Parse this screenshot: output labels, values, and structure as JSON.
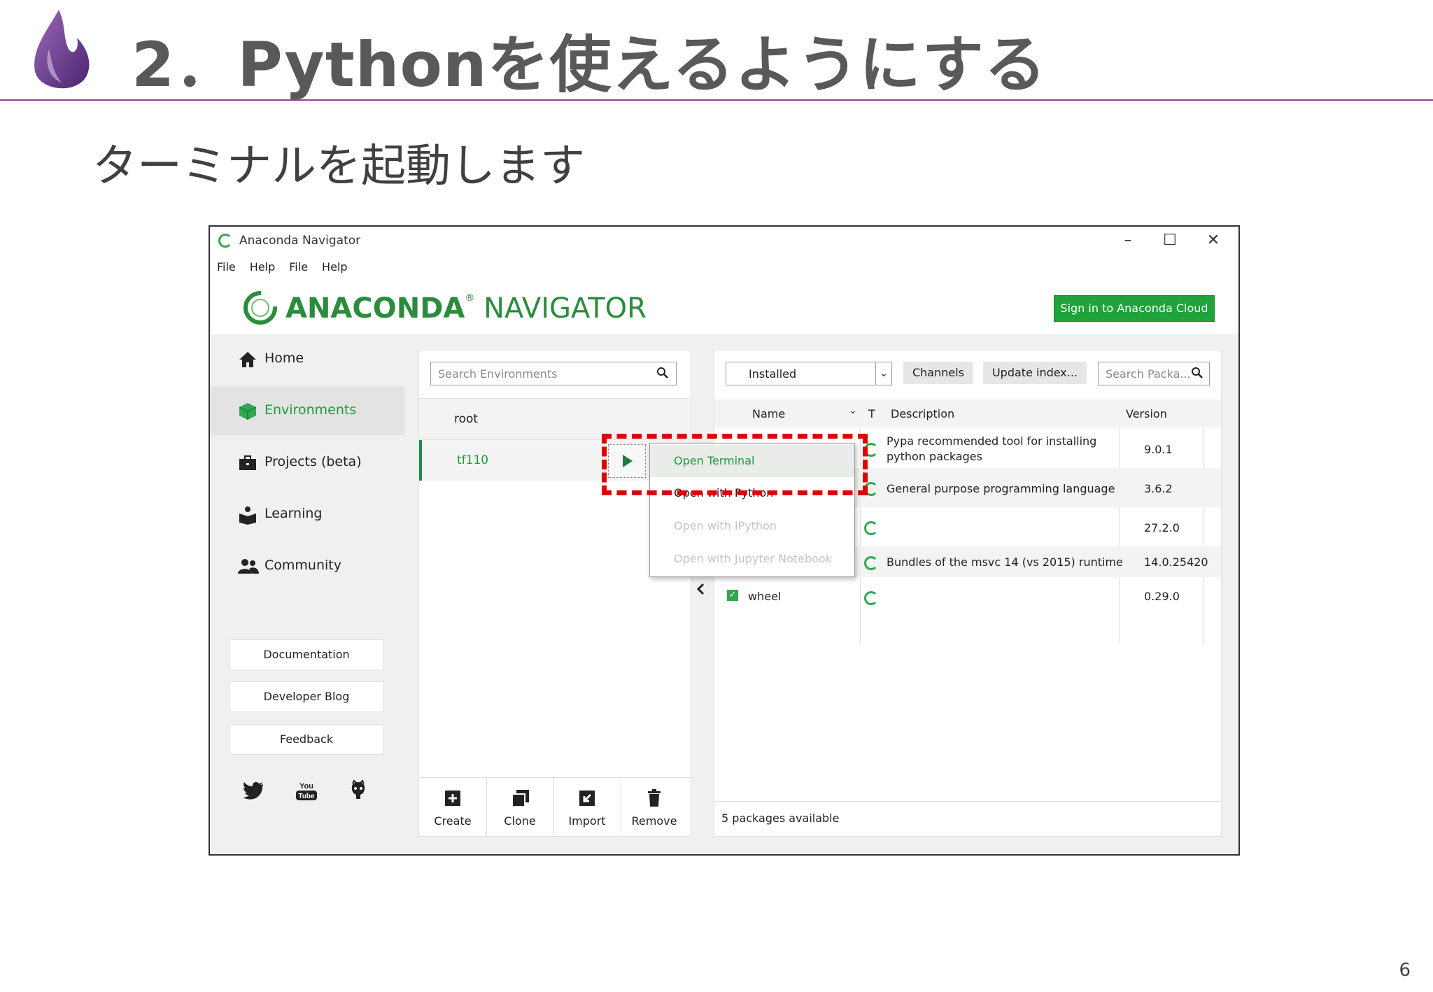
{
  "slide": {
    "title": "2．Pythonを使えるようにする",
    "subtitle": "ターミナルを起動します",
    "page_number": "6"
  },
  "window": {
    "title": "Anaconda Navigator",
    "controls": [
      "–",
      "☐",
      "✕"
    ],
    "menu": [
      "File",
      "Help",
      "File",
      "Help"
    ],
    "brand_bold": "ANACONDA",
    "brand_light": "NAVIGATOR",
    "cloud_button": "Sign in to Anaconda Cloud"
  },
  "sidebar": {
    "items": [
      {
        "label": "Home",
        "icon": "home-icon"
      },
      {
        "label": "Environments",
        "icon": "cube-icon"
      },
      {
        "label": "Projects (beta)",
        "icon": "briefcase-icon"
      },
      {
        "label": "Learning",
        "icon": "learning-icon"
      },
      {
        "label": "Community",
        "icon": "community-icon"
      }
    ],
    "links": [
      "Documentation",
      "Developer Blog",
      "Feedback"
    ],
    "social": [
      "twitter-icon",
      "youtube-icon",
      "github-icon"
    ],
    "youtube_text": "You Tube"
  },
  "environments": {
    "search_placeholder": "Search Environments",
    "rows": [
      "root",
      "tf110"
    ],
    "actions": [
      "Create",
      "Clone",
      "Import",
      "Remove"
    ]
  },
  "context_menu": {
    "items": [
      "Open Terminal",
      "Open with Python",
      "Open with IPython",
      "Open with Jupyter Notebook"
    ]
  },
  "packages": {
    "filter": "Installed",
    "channels": "Channels",
    "update": "Update index...",
    "search_placeholder": "Search Packa...",
    "columns": {
      "name": "Name",
      "t": "T",
      "description": "Description",
      "version": "Version"
    },
    "rows": [
      {
        "name": "",
        "desc1": "Pypa recommended tool for installing",
        "desc2": "python packages",
        "version": "9.0.1"
      },
      {
        "name": "",
        "desc1": "General purpose programming language",
        "desc2": "",
        "version": "3.6.2"
      },
      {
        "name": "",
        "desc1": "",
        "desc2": "",
        "version": "27.2.0"
      },
      {
        "name": "",
        "desc1": "Bundles of the msvc 14 (vs 2015) runtime",
        "desc2": "",
        "version": "14.0.25420"
      },
      {
        "name": "wheel",
        "desc1": "",
        "desc2": "",
        "version": "0.29.0"
      }
    ],
    "footer": "5 packages available"
  },
  "colors": {
    "accent_green": "#1fa33a",
    "title_rule": "#9b3d8e",
    "highlight_red": "#e00000"
  }
}
